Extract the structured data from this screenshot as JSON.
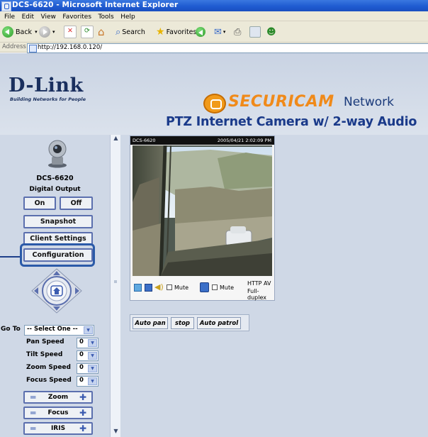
{
  "browser": {
    "title": "DCS-6620 - Microsoft Internet Explorer",
    "menu": [
      "File",
      "Edit",
      "View",
      "Favorites",
      "Tools",
      "Help"
    ],
    "toolbar": {
      "back": "Back",
      "search": "Search",
      "favorites": "Favorites"
    },
    "address_label": "Address",
    "url": "http://192.168.0.120/"
  },
  "header": {
    "brand": "D-Link",
    "brand_tagline": "Building Networks for People",
    "securicam_part1": "SECURI",
    "securicam_part2": "CAM",
    "network": "Network",
    "product_title": "PTZ Internet Camera w/ 2-way Audio"
  },
  "sidebar": {
    "model": "DCS-6620",
    "digital_output_label": "Digital Output",
    "on_label": "On",
    "off_label": "Off",
    "snapshot_label": "Snapshot",
    "client_settings_label": "Client Settings",
    "configuration_label": "Configuration",
    "goto_label": "Go To",
    "goto_value": "-- Select One --",
    "speeds": [
      {
        "label": "Pan Speed",
        "value": "0"
      },
      {
        "label": "Tilt Speed",
        "value": "0"
      },
      {
        "label": "Zoom Speed",
        "value": "0"
      },
      {
        "label": "Focus Speed",
        "value": "0"
      }
    ],
    "zoom_label": "Zoom",
    "focus_label": "Focus",
    "iris_label": "IRIS"
  },
  "video": {
    "camera_name": "DCS-6620",
    "timestamp": "2005/04/21 2:02:09 PM",
    "mute_label_1": "Mute",
    "mute_label_2": "Mute",
    "protocol": "HTTP",
    "mode": "AV",
    "duplex": "Full-duplex"
  },
  "patrol": {
    "auto_pan": "Auto pan",
    "stop": "stop",
    "auto_patrol": "Auto patrol"
  },
  "colors": {
    "titlebar": "#1f5bd1",
    "page_bg": "#cfd8e6",
    "accent_orange": "#f08a1a",
    "brand_navy": "#1a2f5e",
    "highlight_blue": "#2b5aa8"
  }
}
